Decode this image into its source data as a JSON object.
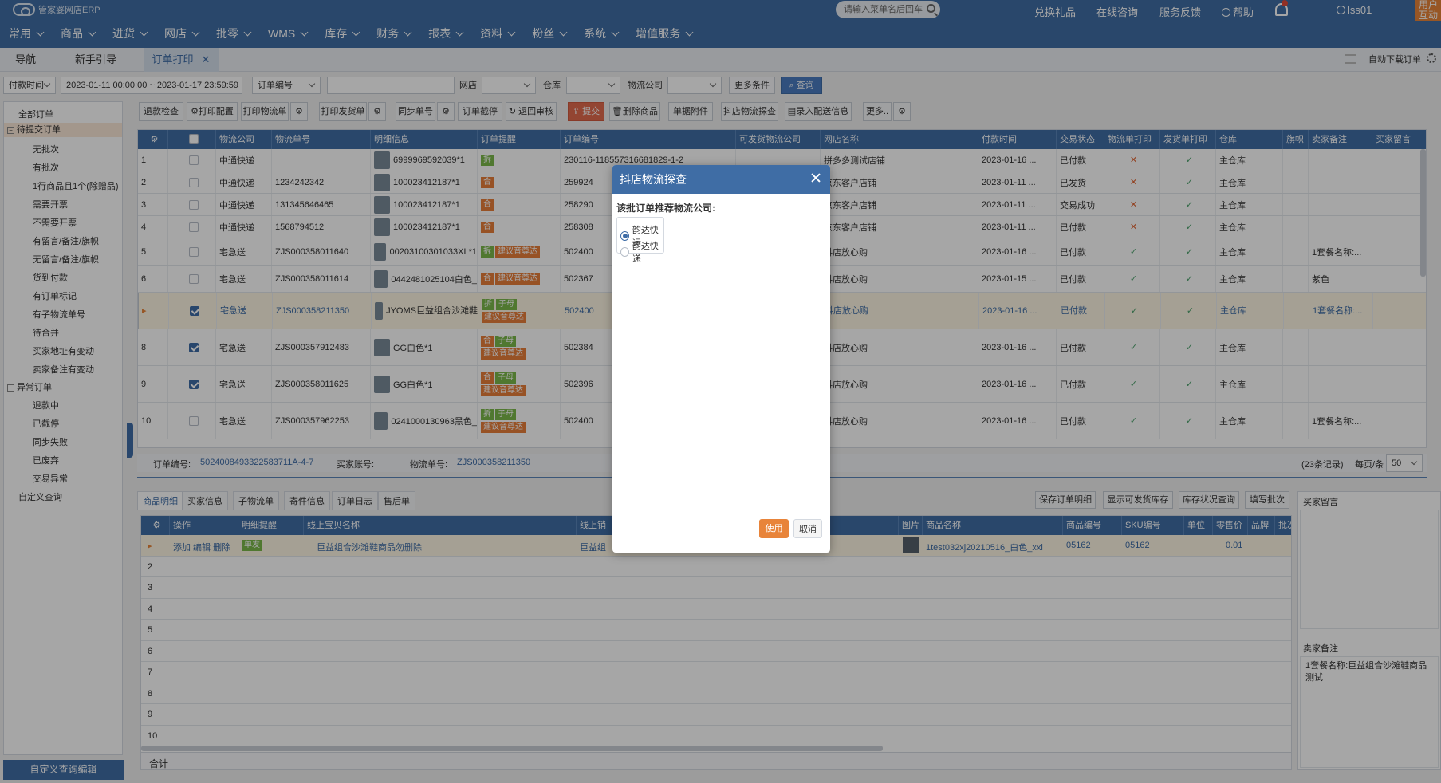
{
  "app": {
    "logo_text": "管家婆网店ERP",
    "search_placeholder": "请输入菜单名后回车",
    "top_links": [
      "兑换礼品",
      "在线咨询",
      "服务反馈",
      "帮助"
    ],
    "username": "lss01",
    "corner_label": "用户互动"
  },
  "menu": [
    "常用",
    "商品",
    "进货",
    "网店",
    "批零",
    "WMS",
    "库存",
    "财务",
    "报表",
    "资料",
    "粉丝",
    "系统",
    "增值服务"
  ],
  "tabs": [
    {
      "label": "导航"
    },
    {
      "label": "新手引导"
    },
    {
      "label": "订单打印",
      "active": true
    }
  ],
  "auto_download": "自动下载订单",
  "filters": {
    "time_type": "付款时间",
    "date_range": "2023-01-11 00:00:00 ~ 2023-01-17 23:59:59",
    "field": "订单编号",
    "store_label": "网店",
    "warehouse_label": "仓库",
    "logistics_label": "物流公司",
    "more_label": "更多条件",
    "query_label": "查询"
  },
  "sidebar": {
    "items": [
      {
        "label": "全部订单",
        "level": 0
      },
      {
        "label": "待提交订单",
        "level": 0,
        "group": true,
        "highlight": true
      },
      {
        "label": "无批次",
        "level": 1
      },
      {
        "label": "有批次",
        "level": 1
      },
      {
        "label": "1行商品且1个(除赠品)",
        "level": 1
      },
      {
        "label": "需要开票",
        "level": 1
      },
      {
        "label": "不需要开票",
        "level": 1
      },
      {
        "label": "有留言/备注/旗帜",
        "level": 1
      },
      {
        "label": "无留言/备注/旗帜",
        "level": 1
      },
      {
        "label": "货到付款",
        "level": 1
      },
      {
        "label": "有订单标记",
        "level": 1
      },
      {
        "label": "有子物流单号",
        "level": 1
      },
      {
        "label": "待合并",
        "level": 1
      },
      {
        "label": "买家地址有变动",
        "level": 1
      },
      {
        "label": "卖家备注有变动",
        "level": 1
      },
      {
        "label": "异常订单",
        "level": 0,
        "group": true
      },
      {
        "label": "退款中",
        "level": 1
      },
      {
        "label": "已截停",
        "level": 1
      },
      {
        "label": "同步失败",
        "level": 1
      },
      {
        "label": "已废弃",
        "level": 1
      },
      {
        "label": "交易异常",
        "level": 1
      },
      {
        "label": "自定义查询",
        "level": 0
      }
    ],
    "footer": "自定义查询编辑"
  },
  "toolbar": [
    "退款检查",
    "打印配置",
    "打印物流单",
    "打印发货单",
    "同步单号",
    "订单截停",
    "返回审核",
    "提交",
    "删除商品",
    "单据附件",
    "抖店物流探查",
    "录入配送信息",
    "更多.."
  ],
  "grid": {
    "columns": [
      "",
      "",
      "物流公司",
      "物流单号",
      "明细信息",
      "订单提醒",
      "订单编号",
      "可发货物流公司",
      "网店名称",
      "付款时间",
      "交易状态",
      "物流单打印",
      "发货单打印",
      "仓库",
      "旗帜",
      "卖家备注",
      "买家留言"
    ],
    "rows": [
      {
        "n": "1",
        "checked": false,
        "company": "中通快递",
        "tracking": "",
        "detail": "6999969592039*1",
        "tags": [
          {
            "t": "拆",
            "c": "g"
          }
        ],
        "order": "230116-118557316681829-1-2",
        "store": "拼多多测试店铺",
        "paytime": "2023-01-16 ...",
        "status": "已付款",
        "print1": "x",
        "print2": "v",
        "warehouse": "主仓库",
        "remark": ""
      },
      {
        "n": "2",
        "checked": false,
        "company": "中通快递",
        "tracking": "1234242342",
        "detail": "100023412187*1",
        "tags": [
          {
            "t": "合",
            "c": "o"
          }
        ],
        "order": "259924",
        "store": "京东客户店铺",
        "paytime": "2023-01-11 ...",
        "status": "已发货",
        "print1": "x",
        "print2": "v",
        "warehouse": "主仓库",
        "remark": ""
      },
      {
        "n": "3",
        "checked": false,
        "company": "中通快递",
        "tracking": "131345646465",
        "detail": "100023412187*1",
        "tags": [
          {
            "t": "合",
            "c": "o"
          }
        ],
        "order": "258290",
        "store": "京东客户店铺",
        "paytime": "2023-01-11 ...",
        "status": "交易成功",
        "print1": "x",
        "print2": "v",
        "warehouse": "主仓库",
        "remark": ""
      },
      {
        "n": "4",
        "checked": false,
        "company": "中通快递",
        "tracking": "1568794512",
        "detail": "100023412187*1",
        "tags": [
          {
            "t": "合",
            "c": "o"
          }
        ],
        "order": "258308",
        "store": "京东客户店铺",
        "paytime": "2023-01-11 ...",
        "status": "已付款",
        "print1": "x",
        "print2": "v",
        "warehouse": "主仓库",
        "remark": ""
      },
      {
        "n": "5",
        "checked": false,
        "company": "宅急送",
        "tracking": "ZJS000358011640",
        "detail": "00203100301033XL*1",
        "tags": [
          {
            "t": "拆",
            "c": "g"
          },
          {
            "t": "建议音尊达",
            "c": "o"
          }
        ],
        "order": "502400",
        "store": "抖店放心购",
        "paytime": "2023-01-16 ...",
        "status": "已付款",
        "print1": "v",
        "print2": "v",
        "warehouse": "主仓库",
        "remark": "1套餐名称:..."
      },
      {
        "n": "6",
        "checked": false,
        "company": "宅急送",
        "tracking": "ZJS000358011614",
        "detail": "0442481025104白色_",
        "tags": [
          {
            "t": "合",
            "c": "o"
          },
          {
            "t": "建议音尊达",
            "c": "o"
          }
        ],
        "order": "502367",
        "store": "抖店放心购",
        "paytime": "2023-01-15 ...",
        "status": "已付款",
        "print1": "v",
        "print2": "v",
        "warehouse": "主仓库",
        "remark": "紫色"
      },
      {
        "n": "▸",
        "checked": true,
        "selected": true,
        "company": "宅急送",
        "tracking": "ZJS000358211350",
        "detail": "JYOMS巨益组合沙滩鞋",
        "tags": [
          {
            "t": "拆",
            "c": "g"
          },
          {
            "t": "子母",
            "c": "g"
          },
          {
            "t": "建议音尊达",
            "c": "o"
          }
        ],
        "order": "502400",
        "store": "抖店放心购",
        "paytime": "2023-01-16 ...",
        "status": "已付款",
        "print1": "v",
        "print2": "v",
        "warehouse": "主仓库",
        "remark": "1套餐名称:..."
      },
      {
        "n": "8",
        "checked": true,
        "company": "宅急送",
        "tracking": "ZJS000357912483",
        "detail": "GG白色*1",
        "tags": [
          {
            "t": "合",
            "c": "o"
          },
          {
            "t": "子母",
            "c": "g"
          },
          {
            "t": "建议音尊达",
            "c": "o"
          }
        ],
        "order": "502384",
        "store": "抖店放心购",
        "paytime": "2023-01-16 ...",
        "status": "已付款",
        "print1": "v",
        "print2": "v",
        "warehouse": "主仓库",
        "remark": ""
      },
      {
        "n": "9",
        "checked": true,
        "company": "宅急送",
        "tracking": "ZJS000358011625",
        "detail": "GG白色*1",
        "tags": [
          {
            "t": "合",
            "c": "o"
          },
          {
            "t": "子母",
            "c": "g"
          },
          {
            "t": "建议音尊达",
            "c": "o"
          }
        ],
        "order": "502396",
        "store": "抖店放心购",
        "paytime": "2023-01-16 ...",
        "status": "已付款",
        "print1": "v",
        "print2": "v",
        "warehouse": "主仓库",
        "remark": ""
      },
      {
        "n": "10",
        "checked": false,
        "company": "宅急送",
        "tracking": "ZJS000357962253",
        "detail": "0241000130963黑色_",
        "tags": [
          {
            "t": "拆",
            "c": "g"
          },
          {
            "t": "子母",
            "c": "g"
          },
          {
            "t": "建议音尊达",
            "c": "o"
          }
        ],
        "order": "502400",
        "store": "抖店放心购",
        "paytime": "2023-01-16 ...",
        "status": "已付款",
        "print1": "v",
        "print2": "v",
        "warehouse": "主仓库",
        "remark": "1套餐名称:..."
      }
    ]
  },
  "grid_footer": {
    "order_label": "订单编号:",
    "order_value": "5024008493322583711A-4-7",
    "buyer_label": "买家账号:",
    "tracking_label": "物流单号:",
    "tracking_value": "ZJS000358211350",
    "records": "(23条记录)",
    "per_page_label": "每页/条",
    "per_page": "50"
  },
  "bottom": {
    "tabs": [
      "商品明细",
      "买家信息",
      "子物流单",
      "寄件信息",
      "订单日志",
      "售后单"
    ],
    "buttons": [
      "保存订单明细",
      "显示可发货库存",
      "库存状况查询",
      "填写批次"
    ],
    "columns": [
      "",
      "操作",
      "明细提醒",
      "线上宝贝名称",
      "线上销",
      "",
      "图片",
      "商品名称",
      "商品编号",
      "SKU编号",
      "单位",
      "零售价",
      "品牌",
      "批次"
    ],
    "row1": {
      "ops": "添加 编辑 删除",
      "tag": "单发",
      "item_name": "巨益组合沙滩鞋商品勿删除",
      "sale": "巨益组",
      "product": "1test032xj20210516_白色_xxl",
      "code": "05162",
      "sku": "05162",
      "price": "0.01"
    },
    "row_numbers": [
      "2",
      "3",
      "4",
      "5",
      "6",
      "7",
      "8",
      "9",
      "10"
    ],
    "total_label": "合计"
  },
  "right_panel": {
    "buyer_msg_label": "买家留言",
    "seller_remark_label": "卖家备注",
    "seller_remark": "1套餐名称:巨益组合沙滩鞋商品测试"
  },
  "modal": {
    "title": "抖店物流探查",
    "question": "该批订单推荐物流公司:",
    "options": [
      {
        "label": "韵达快运",
        "selected": true
      },
      {
        "label": "韵达快递",
        "selected": false
      }
    ],
    "use_label": "使用",
    "cancel_label": "取消"
  },
  "colors": {
    "brand": "#3f6da5",
    "accent_orange": "#e8843a",
    "tag_green": "#7bb84a",
    "check_green": "#4aa06a",
    "cross_orange": "#e0622f"
  }
}
